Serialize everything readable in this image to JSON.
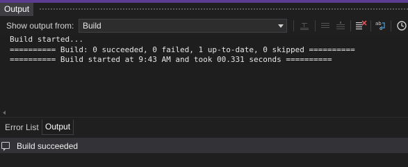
{
  "panel": {
    "title": "Output"
  },
  "toolbar": {
    "show_output_label": "Show output from:",
    "source_value": "Build",
    "icons": [
      "previous-message-icon",
      "next-message-icon",
      "go-to-line-icon",
      "clear-all-icon",
      "word-wrap-icon",
      "find-icon"
    ]
  },
  "output": {
    "lines": [
      "Build started...",
      "========== Build: 0 succeeded, 0 failed, 1 up-to-date, 0 skipped ==========",
      "========== Build started at 9:43 AM and took 00.331 seconds =========="
    ]
  },
  "tabs": [
    {
      "label": "Error List",
      "active": false
    },
    {
      "label": "Output",
      "active": true
    }
  ],
  "status": {
    "text": "Build succeeded"
  },
  "colors": {
    "accent": "#5a3d91",
    "background": "#1f1f1f",
    "clear_icon_red": "#e05555"
  }
}
